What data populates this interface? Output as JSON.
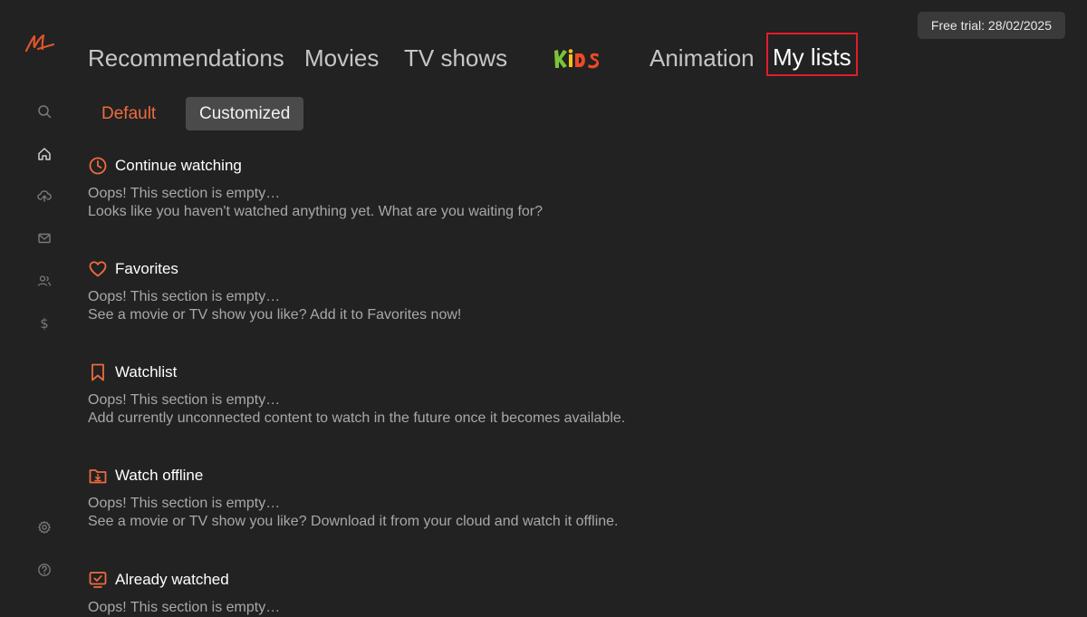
{
  "app": {
    "logo_letter": "M",
    "trial_label": "Free trial: 28/02/2025"
  },
  "sidebar": {
    "items": [
      {
        "icon": "search-icon"
      },
      {
        "icon": "home-icon"
      },
      {
        "icon": "cloud-upload-icon"
      },
      {
        "icon": "mail-icon"
      },
      {
        "icon": "users-icon"
      },
      {
        "icon": "dollar-icon",
        "glyph": "$"
      },
      {
        "icon": "gear-icon"
      },
      {
        "icon": "help-icon"
      }
    ]
  },
  "nav": {
    "tabs": [
      {
        "label": "Recommendations"
      },
      {
        "label": "Movies"
      },
      {
        "label": "TV shows"
      },
      {
        "label": "KIDS"
      },
      {
        "label": "Animation"
      },
      {
        "label": "My lists",
        "selected": true
      }
    ]
  },
  "subtabs": [
    {
      "label": "Default"
    },
    {
      "label": "Customized",
      "selected": true
    }
  ],
  "sections": [
    {
      "title": "Continue watching",
      "icon": "clock-icon",
      "line1": "Oops! This section is empty…",
      "line2": "Looks like you haven't watched anything yet. What are you waiting for?"
    },
    {
      "title": "Favorites",
      "icon": "heart-icon",
      "line1": "Oops! This section is empty…",
      "line2": "See a movie or TV show you like? Add it to Favorites now!"
    },
    {
      "title": "Watchlist",
      "icon": "bookmark-icon",
      "line1": "Oops! This section is empty…",
      "line2": "Add currently unconnected content to watch in the future once it becomes available."
    },
    {
      "title": "Watch offline",
      "icon": "download-folder-icon",
      "line1": "Oops! This section is empty…",
      "line2": "See a movie or TV show you like? Download it from your cloud and watch it offline."
    },
    {
      "title": "Already watched",
      "icon": "watched-tv-icon",
      "line1": "Oops! This section is empty…"
    }
  ],
  "colors": {
    "background": "#222222",
    "accent": "#ec6b3f",
    "selection_outline": "#e21c2b",
    "muted_text": "#a8a8a8"
  }
}
